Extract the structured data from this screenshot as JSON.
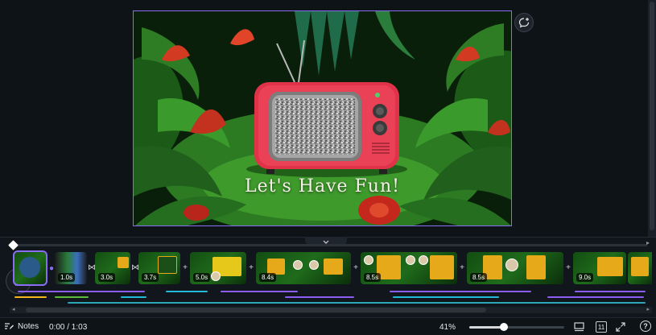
{
  "canvas": {
    "headline": "Let's Have Fun!"
  },
  "timeline": {
    "clips": [
      {
        "duration": ""
      },
      {
        "duration": "1.0s"
      },
      {
        "duration": "3.0s"
      },
      {
        "duration": "3.7s"
      },
      {
        "duration": "5.0s"
      },
      {
        "duration": "8.4s"
      },
      {
        "duration": "8.5s"
      },
      {
        "duration": "8.5s"
      },
      {
        "duration": "9.0s"
      },
      {
        "duration": ""
      }
    ],
    "track_colors": {
      "purple": "#8b5cf6",
      "cyan": "#22b8d8",
      "yellow": "#f2b51a",
      "green": "#5dbb3a",
      "teal": "#2aa8b8"
    }
  },
  "bottombar": {
    "notes_label": "Notes",
    "time": "0:00 / 1:03",
    "zoom": "41%",
    "page_count": "11"
  },
  "colors": {
    "accent": "#8b6cf6",
    "background": "#0e1318"
  },
  "icons": {
    "comment": "comment-add-icon",
    "play": "play-icon",
    "notes": "notes-icon",
    "desktop": "desktop-view-icon",
    "grid": "page-grid-icon",
    "fullscreen": "fullscreen-icon",
    "help": "help-icon"
  }
}
